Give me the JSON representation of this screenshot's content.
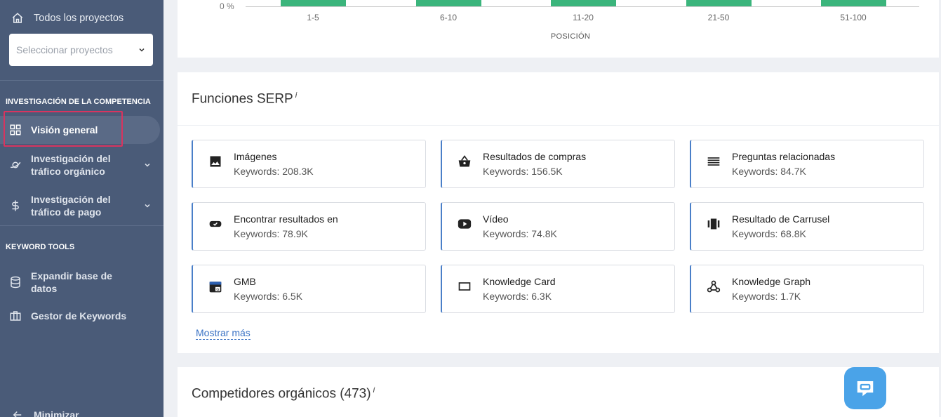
{
  "sidebar": {
    "all_projects": "Todos los proyectos",
    "project_select_placeholder": "Seleccionar proyectos",
    "section_competitor": "INVESTIGACIÓN DE LA COMPETENCIA",
    "section_keyword_tools": "KEYWORD TOOLS",
    "items": [
      {
        "label": "Visión general"
      },
      {
        "label": "Investigación del tráfico orgánico"
      },
      {
        "label": "Investigación del tráfico de pago"
      },
      {
        "label": "Expandir base de datos"
      },
      {
        "label": "Gestor de Keywords"
      }
    ],
    "minimize": "Minimizar"
  },
  "position_chart": {
    "y_tick": "0 %",
    "x_title": "POSICIÓN",
    "categories": [
      "1-5",
      "6-10",
      "11-20",
      "21-50",
      "51-100"
    ]
  },
  "serp": {
    "title": "Funciones SERP",
    "info": "i",
    "features": [
      {
        "name": "Imágenes",
        "count": "Keywords: 208.3K",
        "icon": "image-icon"
      },
      {
        "name": "Resultados de compras",
        "count": "Keywords: 156.5K",
        "icon": "shopping-basket-icon"
      },
      {
        "name": "Preguntas relacionadas",
        "count": "Keywords: 84.7K",
        "icon": "list-icon"
      },
      {
        "name": "Encontrar resultados en",
        "count": "Keywords: 78.9K",
        "icon": "ticket-check-icon"
      },
      {
        "name": "Vídeo",
        "count": "Keywords: 74.8K",
        "icon": "video-icon"
      },
      {
        "name": "Resultado de Carrusel",
        "count": "Keywords: 68.8K",
        "icon": "carousel-icon"
      },
      {
        "name": "GMB",
        "count": "Keywords: 6.5K",
        "icon": "gmb-store-icon"
      },
      {
        "name": "Knowledge Card",
        "count": "Keywords: 6.3K",
        "icon": "card-icon"
      },
      {
        "name": "Knowledge Graph",
        "count": "Keywords: 1.7K",
        "icon": "graph-icon"
      }
    ],
    "show_more": "Mostrar más"
  },
  "competitors": {
    "title": "Competidores orgánicos (473)",
    "info": "i"
  },
  "colors": {
    "sidebar_bg": "#4a5b78",
    "bar_green": "#3bb57c",
    "accent_blue": "#4a7fc8",
    "highlight": "#d8345f",
    "chat_blue": "#4aa3e8"
  }
}
